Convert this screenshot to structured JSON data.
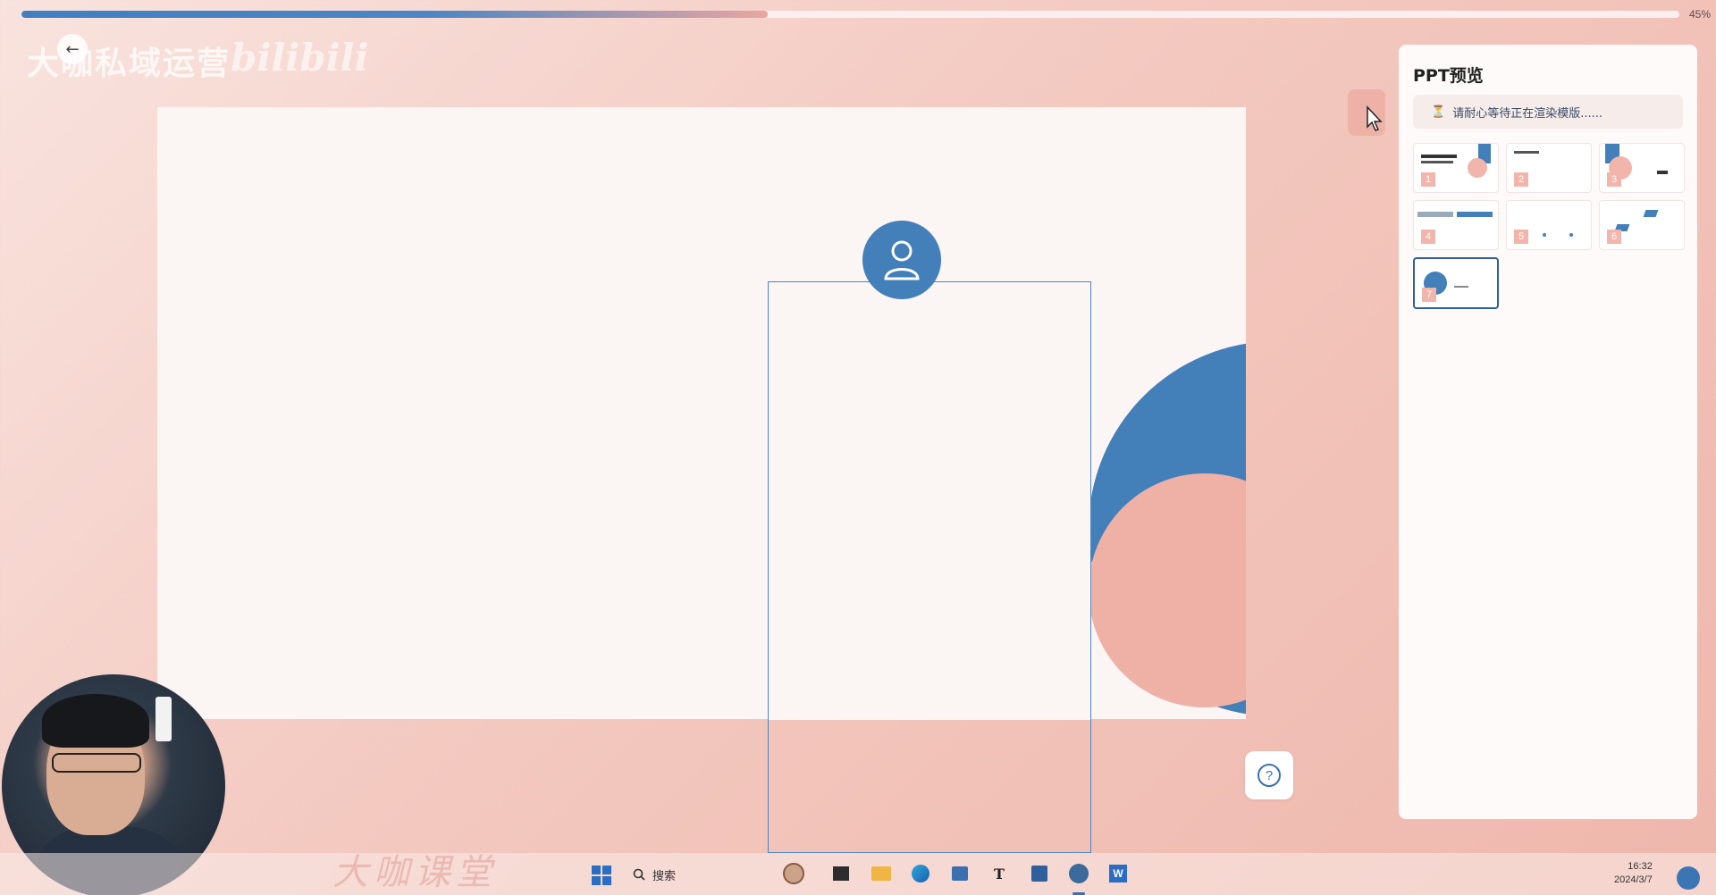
{
  "progress": {
    "percent_label": "45%",
    "fraction": 0.45
  },
  "watermark": {
    "brand": "大咖私域运营",
    "bilibili": "bilibili",
    "footer": "大咖课堂"
  },
  "panel": {
    "title": "PPT预览",
    "loading_text": "请耐心等待正在渲染模版......",
    "thumbnails": [
      {
        "num": "1"
      },
      {
        "num": "2"
      },
      {
        "num": "3"
      },
      {
        "num": "4"
      },
      {
        "num": "5"
      },
      {
        "num": "6"
      },
      {
        "num": "7",
        "selected": true
      }
    ]
  },
  "taskbar": {
    "search_placeholder": "搜索",
    "time": "16:32",
    "date": "2024/3/7",
    "icons": [
      "start-icon",
      "search-icon",
      "widget-icon",
      "terminal-icon",
      "folder-icon",
      "edge-icon",
      "store-icon",
      "typora-icon",
      "calendar-icon",
      "dev-icon",
      "word-icon"
    ]
  },
  "colors": {
    "blue": "#437fb9",
    "pink": "#efb0a6",
    "slide_bg": "#fbf5f4"
  }
}
